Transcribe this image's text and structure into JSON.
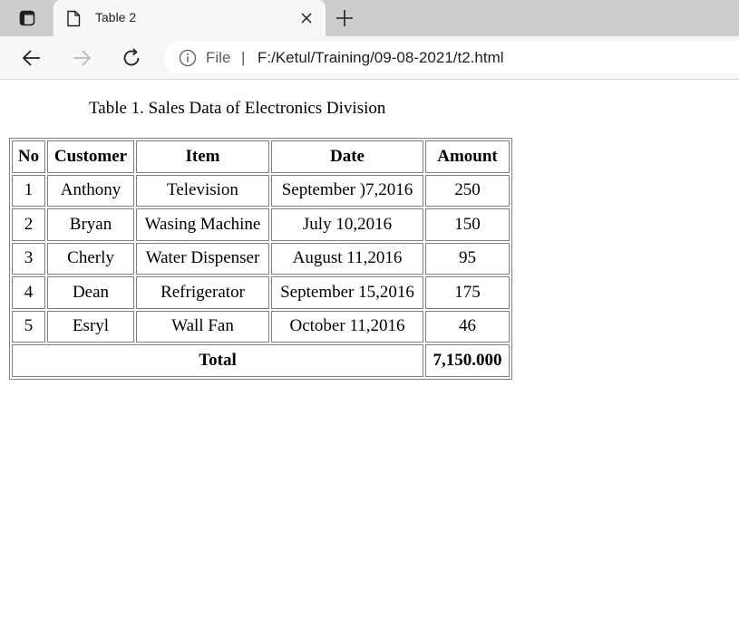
{
  "browser": {
    "tab": {
      "title": "Table 2"
    },
    "address": {
      "scheme_label": "File",
      "separator": "|",
      "url": "F:/Ketul/Training/09-08-2021/t2.html"
    }
  },
  "page": {
    "caption": "Table 1. Sales Data of Electronics Division",
    "table": {
      "headers": {
        "no": "No",
        "customer": "Customer",
        "item": "Item",
        "date": "Date",
        "amount": "Amount"
      },
      "rows": [
        {
          "no": "1",
          "customer": "Anthony",
          "item": "Television",
          "date": "September )7,2016",
          "amount": "250"
        },
        {
          "no": "2",
          "customer": "Bryan",
          "item": "Wasing Machine",
          "date": "July 10,2016",
          "amount": "150"
        },
        {
          "no": "3",
          "customer": "Cherly",
          "item": "Water Dispenser",
          "date": "August 11,2016",
          "amount": "95"
        },
        {
          "no": "4",
          "customer": "Dean",
          "item": "Refrigerator",
          "date": "September 15,2016",
          "amount": "175"
        },
        {
          "no": "5",
          "customer": "Esryl",
          "item": "Wall Fan",
          "date": "October 11,2016",
          "amount": "46"
        }
      ],
      "footer": {
        "label": "Total",
        "amount": "7,150.000"
      }
    }
  },
  "icons": {
    "tab_actions": "tab-actions-icon",
    "page": "page-icon",
    "close": "close-icon",
    "new_tab": "plus-icon",
    "back": "arrow-left-icon",
    "forward": "arrow-right-icon",
    "refresh": "refresh-icon",
    "info": "info-icon"
  },
  "colors": {
    "tabbar_bg": "#cdcdcd",
    "toolbar_bg": "#f7f7f7",
    "table_border": "#808080"
  }
}
